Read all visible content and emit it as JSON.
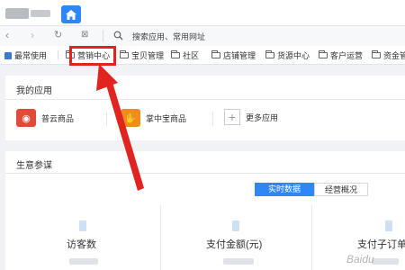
{
  "addressbar": {
    "search_text": "搜索应用、常用网址"
  },
  "bookmarks": {
    "frequent_label": "最常使用",
    "items": [
      "营销中心",
      "宝贝管理",
      "社区",
      "店铺管理",
      "货源中心",
      "客户运营",
      "资金管"
    ]
  },
  "my_apps": {
    "title": "我的应用",
    "items": [
      {
        "label": "普云商品",
        "icon": "puyun-app-icon",
        "color": "#e04a36"
      },
      {
        "label": "掌中宝商品",
        "icon": "zhangzhongbao-app-icon",
        "color": "#f08c1e"
      }
    ],
    "more_label": "更多应用"
  },
  "business": {
    "title": "生意参谋",
    "tabs": [
      {
        "label": "实时数据",
        "active": true
      },
      {
        "label": "经营概况",
        "active": false
      }
    ],
    "stats": [
      "访客数",
      "支付金额(元)",
      "支付子订单"
    ]
  },
  "annotation": {
    "color": "#e0241f"
  },
  "watermark": "Baidu"
}
